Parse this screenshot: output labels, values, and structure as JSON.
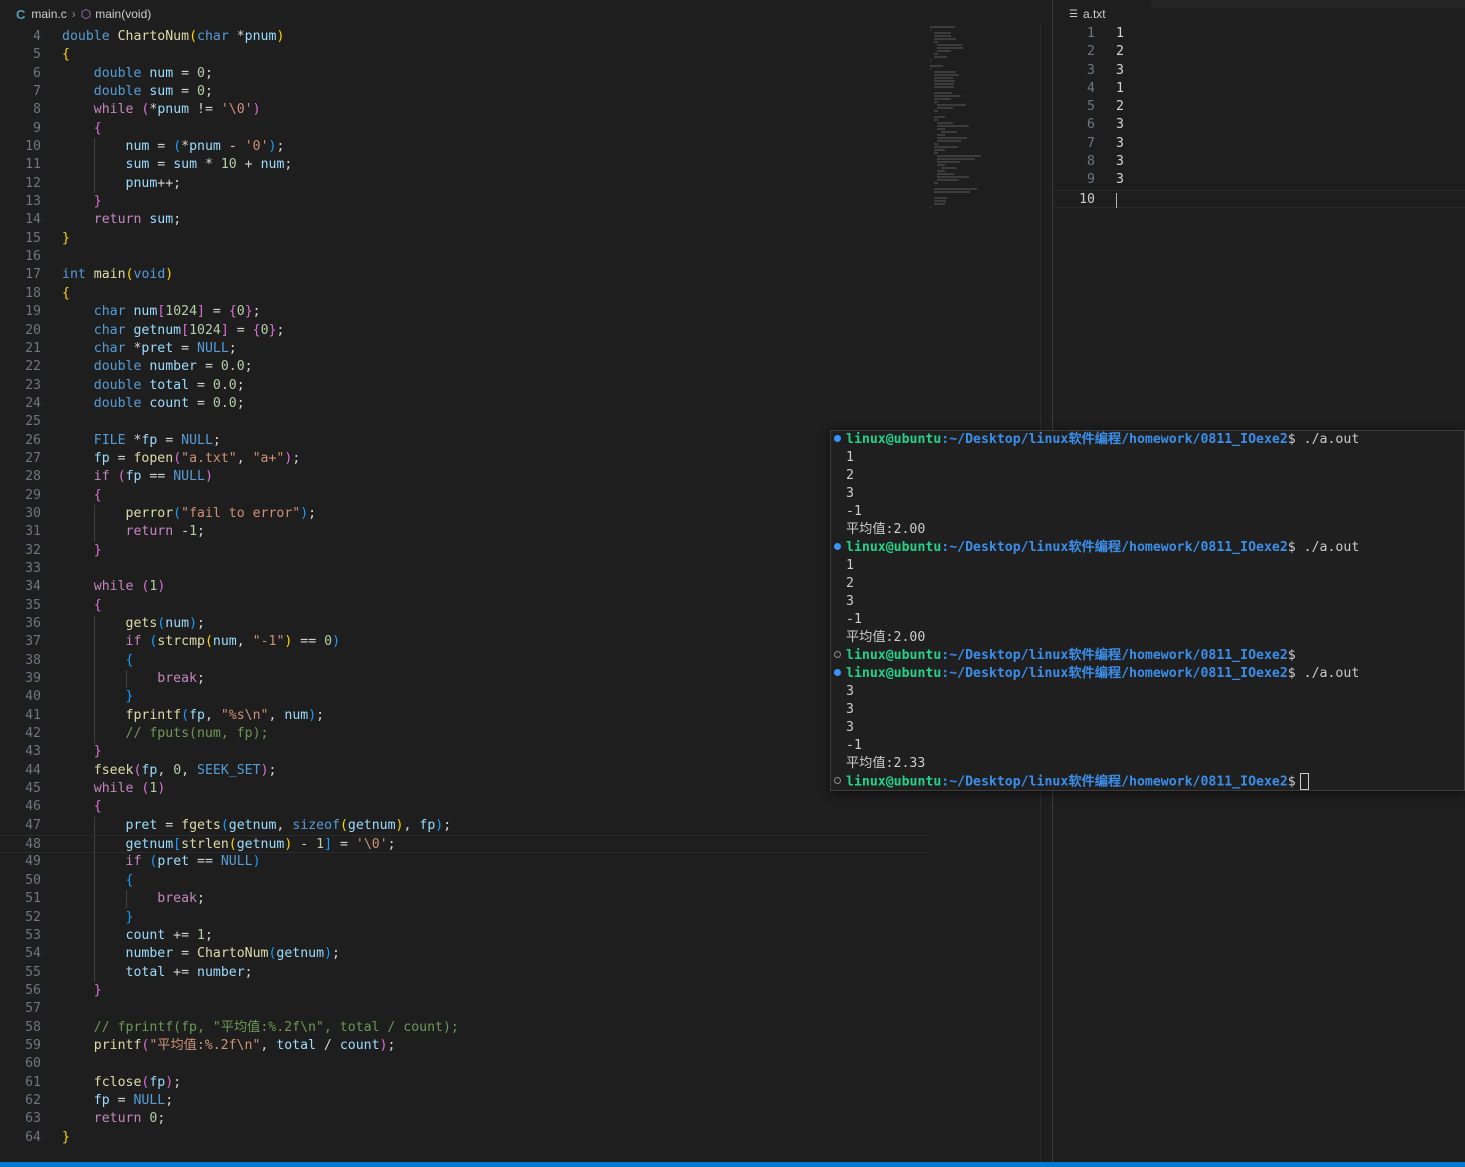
{
  "breadcrumb": {
    "file": "main.c",
    "symbol": "main(void)",
    "file_icon": "C",
    "symbol_icon": "cube-icon"
  },
  "code": [
    {
      "n": "4",
      "html": "<span class='kw'>double</span> <span class='fn'>ChartoNum</span><span class='br1'>(</span><span class='kw'>char</span> *<span class='var'>pnum</span><span class='br1'>)</span>",
      "guides": []
    },
    {
      "n": "5",
      "html": "<span class='br1'>{</span>",
      "guides": []
    },
    {
      "n": "6",
      "html": "    <span class='kw'>double</span> <span class='var'>num</span> = <span class='num'>0</span>;",
      "guides": []
    },
    {
      "n": "7",
      "html": "    <span class='kw'>double</span> <span class='var'>sum</span> = <span class='num'>0</span>;",
      "guides": []
    },
    {
      "n": "8",
      "html": "    <span class='ctl'>while</span> <span class='br2'>(</span>*<span class='var'>pnum</span> != <span class='str'>'\\0'</span><span class='br2'>)</span>",
      "guides": []
    },
    {
      "n": "9",
      "html": "    <span class='br2'>{</span>",
      "guides": []
    },
    {
      "n": "10",
      "html": "        <span class='var'>num</span> = <span class='br3'>(</span>*<span class='var'>pnum</span> - <span class='str'>'0'</span><span class='br3'>)</span>;",
      "guides": [
        1
      ]
    },
    {
      "n": "11",
      "html": "        <span class='var'>sum</span> = <span class='var'>sum</span> * <span class='num'>10</span> + <span class='var'>num</span>;",
      "guides": [
        1
      ]
    },
    {
      "n": "12",
      "html": "        <span class='var'>pnum</span>++;",
      "guides": [
        1
      ]
    },
    {
      "n": "13",
      "html": "    <span class='br2'>}</span>",
      "guides": []
    },
    {
      "n": "14",
      "html": "    <span class='ctl'>return</span> <span class='var'>sum</span>;",
      "guides": []
    },
    {
      "n": "15",
      "html": "<span class='br1'>}</span>",
      "guides": []
    },
    {
      "n": "16",
      "html": "",
      "guides": []
    },
    {
      "n": "17",
      "html": "<span class='kw'>int</span> <span class='fn'>main</span><span class='br1'>(</span><span class='kw'>void</span><span class='br1'>)</span>",
      "guides": []
    },
    {
      "n": "18",
      "html": "<span class='br1'>{</span>",
      "guides": []
    },
    {
      "n": "19",
      "html": "    <span class='kw'>char</span> <span class='var'>num</span><span class='br2'>[</span><span class='num'>1024</span><span class='br2'>]</span> = <span class='br2'>{</span><span class='num'>0</span><span class='br2'>}</span>;",
      "guides": []
    },
    {
      "n": "20",
      "html": "    <span class='kw'>char</span> <span class='var'>getnum</span><span class='br2'>[</span><span class='num'>1024</span><span class='br2'>]</span> = <span class='br2'>{</span><span class='num'>0</span><span class='br2'>}</span>;",
      "guides": []
    },
    {
      "n": "21",
      "html": "    <span class='kw'>char</span> *<span class='var'>pret</span> = <span class='mac'>NULL</span>;",
      "guides": []
    },
    {
      "n": "22",
      "html": "    <span class='kw'>double</span> <span class='var'>number</span> = <span class='num'>0.0</span>;",
      "guides": []
    },
    {
      "n": "23",
      "html": "    <span class='kw'>double</span> <span class='var'>total</span> = <span class='num'>0.0</span>;",
      "guides": []
    },
    {
      "n": "24",
      "html": "    <span class='kw'>double</span> <span class='var'>count</span> = <span class='num'>0.0</span>;",
      "guides": []
    },
    {
      "n": "25",
      "html": "",
      "guides": []
    },
    {
      "n": "26",
      "html": "    <span class='kw'>FILE</span> *<span class='var'>fp</span> = <span class='mac'>NULL</span>;",
      "guides": []
    },
    {
      "n": "27",
      "html": "    <span class='var'>fp</span> = <span class='fn'>fopen</span><span class='br2'>(</span><span class='str'>\"a.txt\"</span>, <span class='str'>\"a+\"</span><span class='br2'>)</span>;",
      "guides": []
    },
    {
      "n": "28",
      "html": "    <span class='ctl'>if</span> <span class='br2'>(</span><span class='var'>fp</span> == <span class='mac'>NULL</span><span class='br2'>)</span>",
      "guides": []
    },
    {
      "n": "29",
      "html": "    <span class='br2'>{</span>",
      "guides": []
    },
    {
      "n": "30",
      "html": "        <span class='fn'>perror</span><span class='br3'>(</span><span class='str'>\"fail to error\"</span><span class='br3'>)</span>;",
      "guides": [
        1
      ]
    },
    {
      "n": "31",
      "html": "        <span class='ctl'>return</span> -<span class='num'>1</span>;",
      "guides": [
        1
      ]
    },
    {
      "n": "32",
      "html": "    <span class='br2'>}</span>",
      "guides": []
    },
    {
      "n": "33",
      "html": "",
      "guides": []
    },
    {
      "n": "34",
      "html": "    <span class='ctl'>while</span> <span class='br2'>(</span><span class='num'>1</span><span class='br2'>)</span>",
      "guides": []
    },
    {
      "n": "35",
      "html": "    <span class='br2'>{</span>",
      "guides": []
    },
    {
      "n": "36",
      "html": "        <span class='fn'>gets</span><span class='br3'>(</span><span class='var'>num</span><span class='br3'>)</span>;",
      "guides": [
        1
      ]
    },
    {
      "n": "37",
      "html": "        <span class='ctl'>if</span> <span class='br3'>(</span><span class='fn'>strcmp</span><span class='br1'>(</span><span class='var'>num</span>, <span class='str'>\"-1\"</span><span class='br1'>)</span> == <span class='num'>0</span><span class='br3'>)</span>",
      "guides": [
        1
      ]
    },
    {
      "n": "38",
      "html": "        <span class='br3'>{</span>",
      "guides": [
        1
      ]
    },
    {
      "n": "39",
      "html": "            <span class='ctl'>break</span>;",
      "guides": [
        1,
        2
      ]
    },
    {
      "n": "40",
      "html": "        <span class='br3'>}</span>",
      "guides": [
        1
      ]
    },
    {
      "n": "41",
      "html": "        <span class='fn'>fprintf</span><span class='br3'>(</span><span class='var'>fp</span>, <span class='str'>\"%s\\n\"</span>, <span class='var'>num</span><span class='br3'>)</span>;",
      "guides": [
        1
      ]
    },
    {
      "n": "42",
      "html": "        <span class='cmt'>// fputs(num, fp);</span>",
      "guides": [
        1
      ]
    },
    {
      "n": "43",
      "html": "    <span class='br2'>}</span>",
      "guides": []
    },
    {
      "n": "44",
      "html": "    <span class='fn'>fseek</span><span class='br2'>(</span><span class='var'>fp</span>, <span class='num'>0</span>, <span class='mac'>SEEK_SET</span><span class='br2'>)</span>;",
      "guides": []
    },
    {
      "n": "45",
      "html": "    <span class='ctl'>while</span> <span class='br2'>(</span><span class='num'>1</span><span class='br2'>)</span>",
      "guides": []
    },
    {
      "n": "46",
      "html": "    <span class='br2'>{</span>",
      "guides": []
    },
    {
      "n": "47",
      "html": "        <span class='var'>pret</span> = <span class='fn'>fgets</span><span class='br3'>(</span><span class='var'>getnum</span>, <span class='kw'>sizeof</span><span class='br1'>(</span><span class='var'>getnum</span><span class='br1'>)</span>, <span class='var'>fp</span><span class='br3'>)</span>;",
      "guides": [
        1
      ]
    },
    {
      "n": "48",
      "html": "        <span class='var'>getnum</span><span class='br3'>[</span><span class='fn'>strlen</span><span class='br1'>(</span><span class='var'>getnum</span><span class='br1'>)</span> - <span class='num'>1</span><span class='br3'>]</span> = <span class='str'>'\\0'</span>;",
      "guides": [
        1
      ],
      "current": true
    },
    {
      "n": "49",
      "html": "        <span class='ctl'>if</span> <span class='br3'>(</span><span class='var'>pret</span> == <span class='mac'>NULL</span><span class='br3'>)</span>",
      "guides": [
        1
      ]
    },
    {
      "n": "50",
      "html": "        <span class='br3'>{</span>",
      "guides": [
        1
      ]
    },
    {
      "n": "51",
      "html": "            <span class='ctl'>break</span>;",
      "guides": [
        1,
        2
      ]
    },
    {
      "n": "52",
      "html": "        <span class='br3'>}</span>",
      "guides": [
        1
      ]
    },
    {
      "n": "53",
      "html": "        <span class='var'>count</span> += <span class='num'>1</span>;",
      "guides": [
        1
      ]
    },
    {
      "n": "54",
      "html": "        <span class='var'>number</span> = <span class='fn'>ChartoNum</span><span class='br3'>(</span><span class='var'>getnum</span><span class='br3'>)</span>;",
      "guides": [
        1
      ]
    },
    {
      "n": "55",
      "html": "        <span class='var'>total</span> += <span class='var'>number</span>;",
      "guides": [
        1
      ]
    },
    {
      "n": "56",
      "html": "    <span class='br2'>}</span>",
      "guides": []
    },
    {
      "n": "57",
      "html": "",
      "guides": []
    },
    {
      "n": "58",
      "html": "    <span class='cmt'>// fprintf(fp, \"平均值:%.2f\\n\", total / count);</span>",
      "guides": []
    },
    {
      "n": "59",
      "html": "    <span class='fn'>printf</span><span class='br2'>(</span><span class='str'>\"平均值:%.2f\\n\"</span>, <span class='var'>total</span> / <span class='var'>count</span><span class='br2'>)</span>;",
      "guides": []
    },
    {
      "n": "60",
      "html": "",
      "guides": []
    },
    {
      "n": "61",
      "html": "    <span class='fn'>fclose</span><span class='br2'>(</span><span class='var'>fp</span><span class='br2'>)</span>;",
      "guides": []
    },
    {
      "n": "62",
      "html": "    <span class='var'>fp</span> = <span class='mac'>NULL</span>;",
      "guides": []
    },
    {
      "n": "63",
      "html": "    <span class='ctl'>return</span> <span class='num'>0</span>;",
      "guides": []
    },
    {
      "n": "64",
      "html": "<span class='br1'>}</span>",
      "guides": []
    }
  ],
  "right_editor": {
    "tab_label": "a.txt",
    "tab_icon": "list-icon",
    "lines": [
      {
        "n": "1",
        "text": "1"
      },
      {
        "n": "2",
        "text": "2"
      },
      {
        "n": "3",
        "text": "3"
      },
      {
        "n": "4",
        "text": "1"
      },
      {
        "n": "5",
        "text": "2"
      },
      {
        "n": "6",
        "text": "3"
      },
      {
        "n": "7",
        "text": "3"
      },
      {
        "n": "8",
        "text": "3"
      },
      {
        "n": "9",
        "text": "3"
      },
      {
        "n": "10",
        "text": "",
        "current": true
      }
    ]
  },
  "terminal": {
    "lines": [
      {
        "type": "prompt",
        "dot": "filled",
        "user": "linux@ubuntu",
        "path": ":~/Desktop/linux软件编程/homework/0811_IOexe2",
        "cmd": "$ ./a.out"
      },
      {
        "type": "out",
        "text": "1"
      },
      {
        "type": "out",
        "text": "2"
      },
      {
        "type": "out",
        "text": "3"
      },
      {
        "type": "out",
        "text": "-1"
      },
      {
        "type": "out",
        "text": "平均值:2.00"
      },
      {
        "type": "prompt",
        "dot": "filled",
        "user": "linux@ubuntu",
        "path": ":~/Desktop/linux软件编程/homework/0811_IOexe2",
        "cmd": "$ ./a.out"
      },
      {
        "type": "out",
        "text": "1"
      },
      {
        "type": "out",
        "text": "2"
      },
      {
        "type": "out",
        "text": "3"
      },
      {
        "type": "out",
        "text": "-1"
      },
      {
        "type": "out",
        "text": "平均值:2.00"
      },
      {
        "type": "prompt",
        "dot": "hollow",
        "user": "linux@ubuntu",
        "path": ":~/Desktop/linux软件编程/homework/0811_IOexe2",
        "cmd": "$"
      },
      {
        "type": "prompt",
        "dot": "filled",
        "user": "linux@ubuntu",
        "path": ":~/Desktop/linux软件编程/homework/0811_IOexe2",
        "cmd": "$ ./a.out"
      },
      {
        "type": "out",
        "text": "3"
      },
      {
        "type": "out",
        "text": "3"
      },
      {
        "type": "out",
        "text": "3"
      },
      {
        "type": "out",
        "text": "-1"
      },
      {
        "type": "out",
        "text": "平均值:2.33"
      },
      {
        "type": "prompt",
        "dot": "hollow",
        "user": "linux@ubuntu",
        "path": ":~/Desktop/linux软件编程/homework/0811_IOexe2",
        "cmd": "$",
        "cursor": true
      }
    ]
  },
  "colors": {
    "background": "#1e1e1e",
    "status_bar": "#007acc",
    "terminal_user": "#23d18b",
    "terminal_path": "#3b8eea"
  }
}
